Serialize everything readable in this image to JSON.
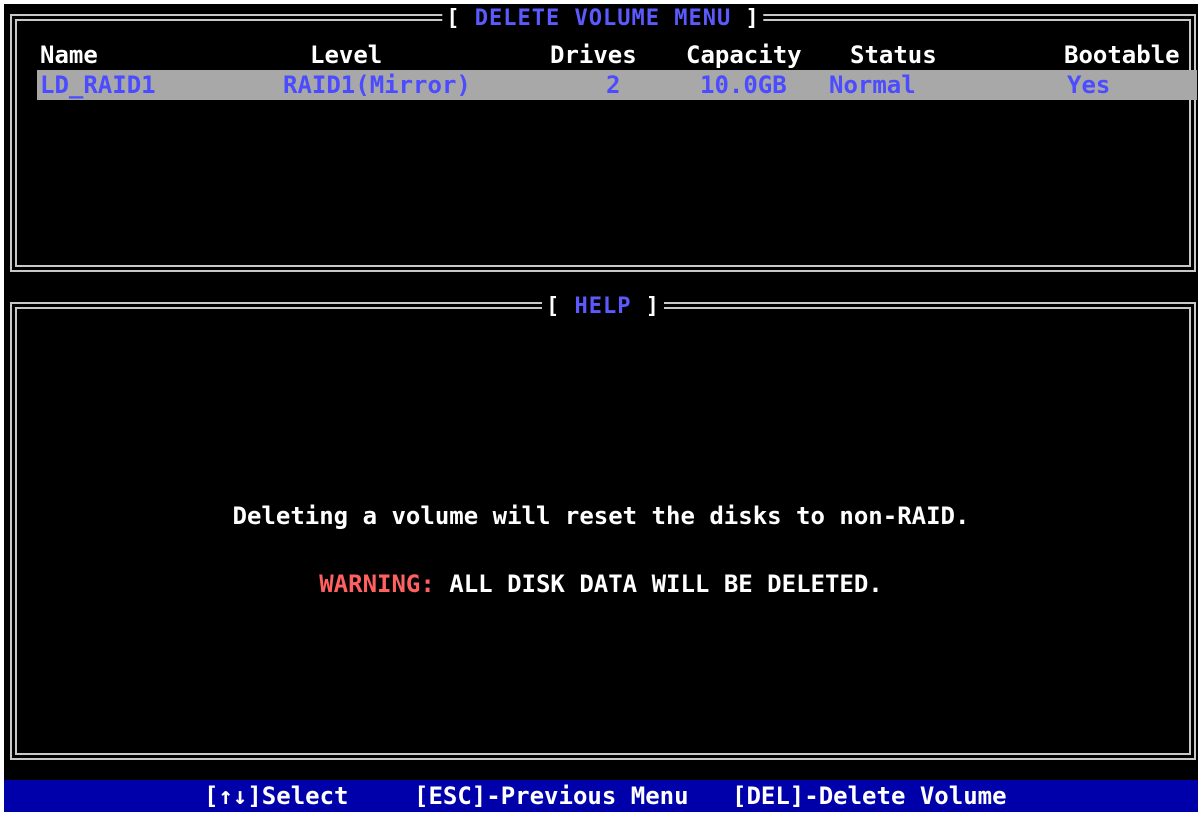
{
  "volume_menu": {
    "title": "DELETE VOLUME MENU",
    "columns": [
      "Name",
      "Level",
      "Drives",
      "Capacity",
      "Status",
      "Bootable"
    ],
    "rows": [
      {
        "name": "LD_RAID1",
        "level": "RAID1(Mirror)",
        "drives": "2",
        "capacity": "10.0GB",
        "status": "Normal",
        "bootable": "Yes"
      }
    ]
  },
  "help": {
    "title": "HELP",
    "line1": "Deleting a volume will reset the disks to non-RAID.",
    "warning_label": "WARNING:",
    "warning_text": "ALL DISK DATA WILL BE DELETED."
  },
  "footer": {
    "select": "[↑↓]Select",
    "previous": "[ESC]-Previous Menu",
    "delete": "[DEL]-Delete Volume"
  },
  "colors": {
    "background": "#000000",
    "frame": "#c8c8c8",
    "title_text": "#5a5aff",
    "selected_row_bg": "#a8a8a8",
    "selected_row_text": "#4b4bff",
    "warning": "#ff6060",
    "footer_bg": "#0000aa"
  }
}
